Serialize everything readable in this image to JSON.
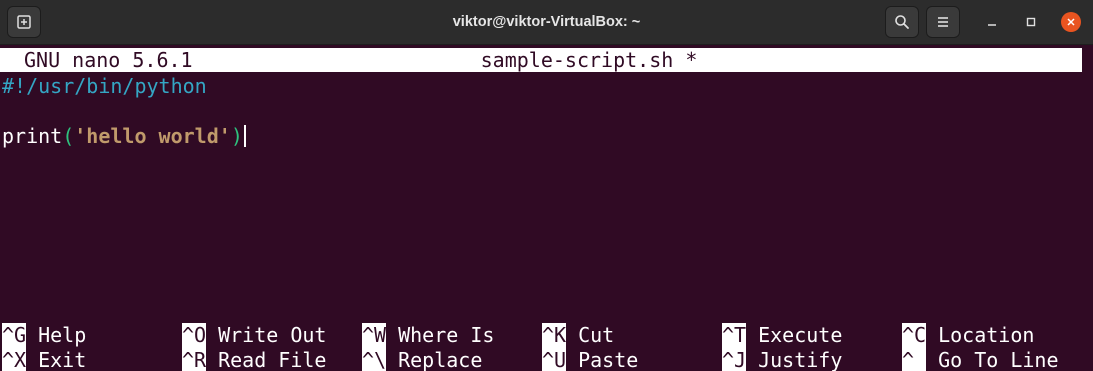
{
  "window": {
    "title": "viktor@viktor-VirtualBox: ~",
    "buttons": {
      "new_tab_icon": "new-tab-icon",
      "search_icon": "search-icon",
      "menu_icon": "hamburger-menu-icon",
      "minimize_icon": "minimize-icon",
      "maximize_icon": "maximize-icon",
      "close_icon": "close-icon"
    },
    "colors": {
      "titlebar": "#2c2c2c",
      "terminal_bg": "#300a24",
      "close_button": "#e95420"
    }
  },
  "nano": {
    "version": "GNU nano 5.6.1",
    "filename": "sample-script.sh *",
    "lines": {
      "line1": "#!/usr/bin/python",
      "line3": {
        "func": "print",
        "open_paren": "(",
        "string": "'hello world'",
        "close_paren": ")"
      }
    },
    "shortcuts": {
      "row1": [
        {
          "key": "^G",
          "label": "Help"
        },
        {
          "key": "^O",
          "label": "Write Out"
        },
        {
          "key": "^W",
          "label": "Where Is"
        },
        {
          "key": "^K",
          "label": "Cut"
        },
        {
          "key": "^T",
          "label": "Execute"
        },
        {
          "key": "^C",
          "label": "Location"
        }
      ],
      "row2": [
        {
          "key": "^X",
          "label": "Exit"
        },
        {
          "key": "^R",
          "label": "Read File"
        },
        {
          "key": "^\\",
          "label": "Replace"
        },
        {
          "key": "^U",
          "label": "Paste"
        },
        {
          "key": "^J",
          "label": "Justify"
        },
        {
          "key": "^_",
          "label": "Go To Line"
        }
      ]
    },
    "syntax_colors": {
      "comment": "#34a6c4",
      "paren": "#2ec27e",
      "string": "#c09a6b"
    }
  }
}
